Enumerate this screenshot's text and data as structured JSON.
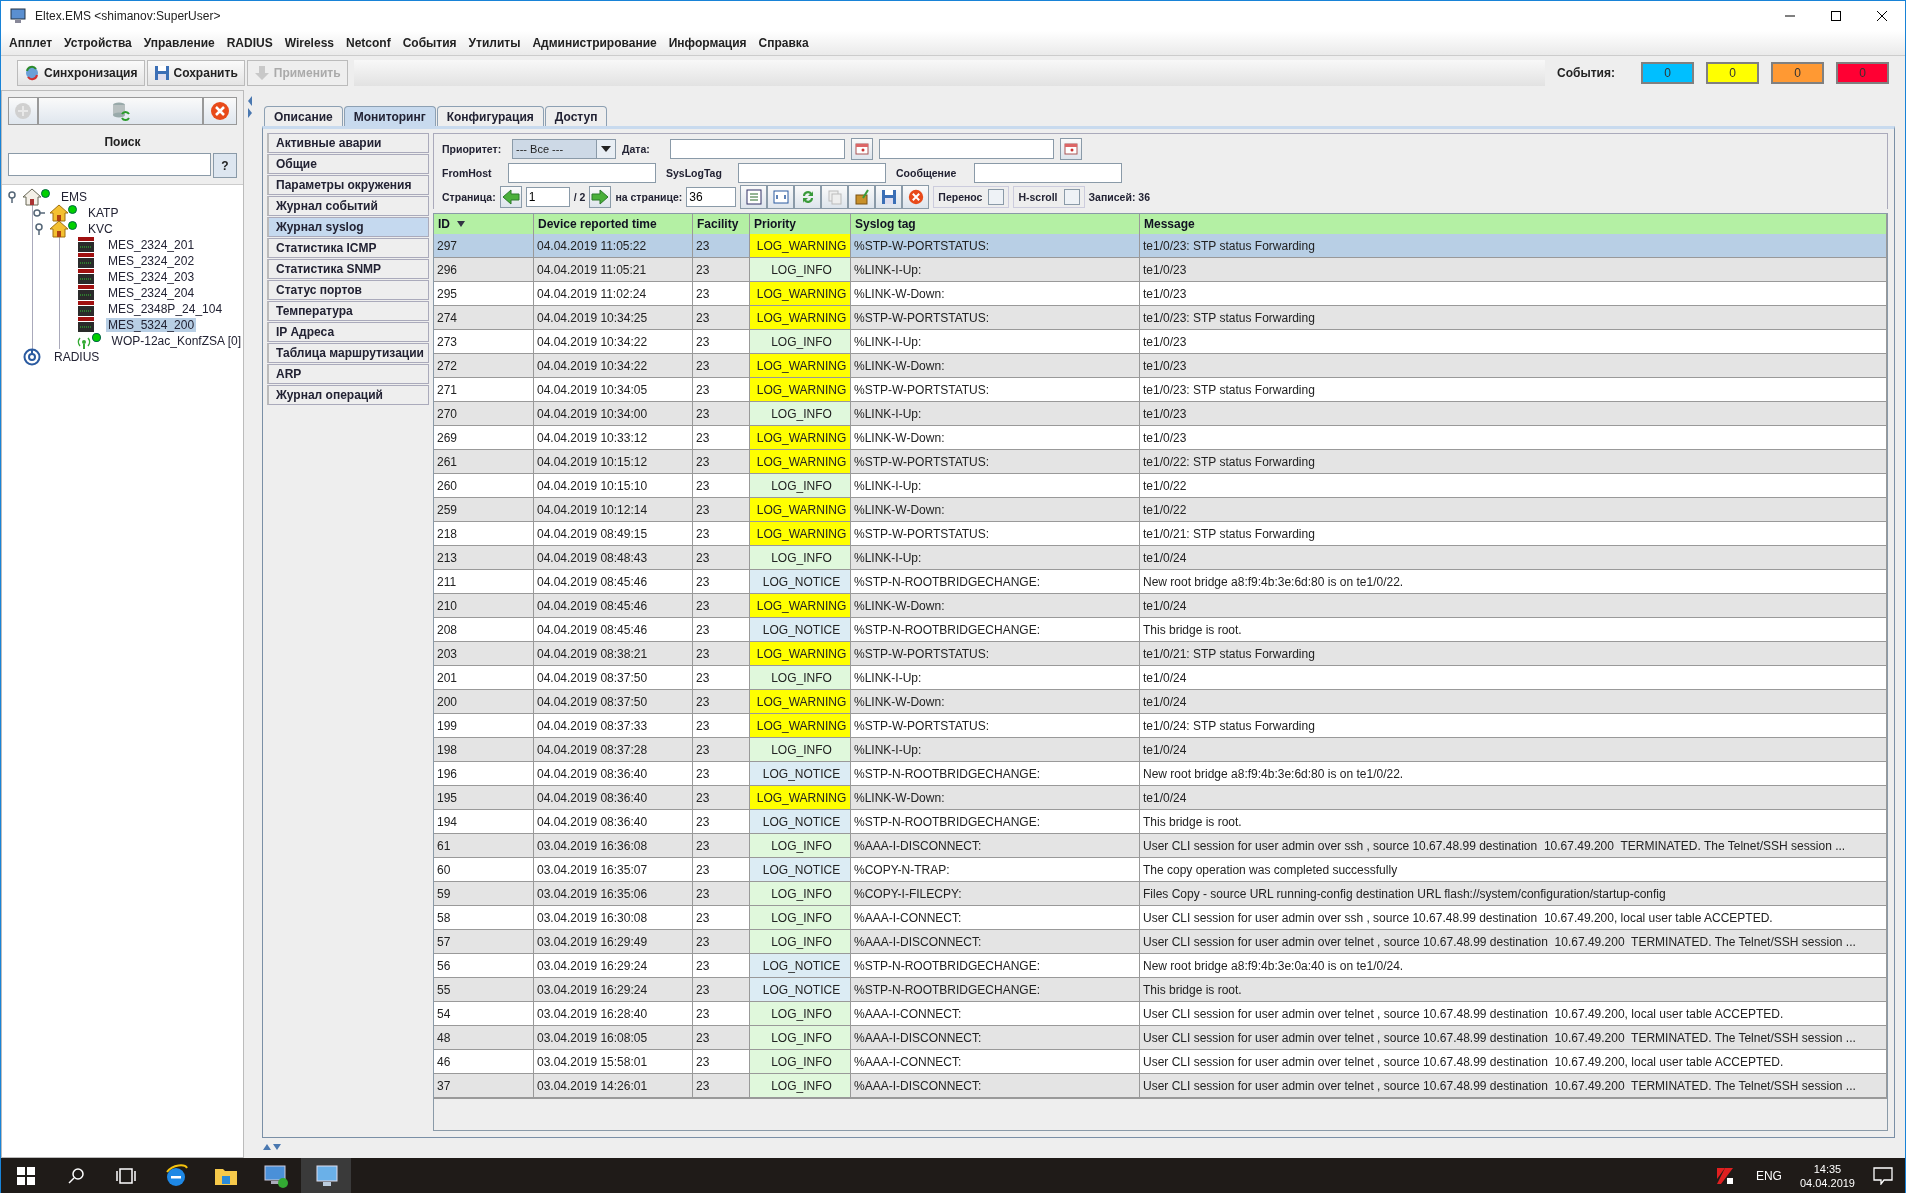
{
  "window": {
    "title": "Eltex.EMS <shimanov:SuperUser>"
  },
  "menu": [
    "Апплет",
    "Устройства",
    "Управление",
    "RADIUS",
    "Wireless",
    "Netconf",
    "События",
    "Утилиты",
    "Администрирование",
    "Информация",
    "Справка"
  ],
  "toolbar": [
    {
      "label": "Синхронизация",
      "kind": "sync",
      "disabled": false
    },
    {
      "label": "Сохранить",
      "kind": "save",
      "disabled": false
    },
    {
      "label": "Применить",
      "kind": "apply",
      "disabled": true
    }
  ],
  "events": {
    "label": "События:",
    "counters": [
      {
        "value": "0",
        "color": "#00bfff"
      },
      {
        "value": "0",
        "color": "#ffff00"
      },
      {
        "value": "0",
        "color": "#ff9933"
      },
      {
        "value": "0",
        "color": "#ff0033"
      }
    ]
  },
  "left_panel": {
    "search_label": "Поиск",
    "help_button": "?",
    "tree": [
      {
        "label": "EMS",
        "kind": "root",
        "online": true,
        "expanded": true,
        "selected": false,
        "children": [
          {
            "label": "KATP",
            "kind": "site",
            "online": true,
            "expanded": false,
            "selected": false
          },
          {
            "label": "KVC",
            "kind": "site",
            "online": true,
            "expanded": true,
            "selected": false,
            "children": [
              {
                "label": "MES_2324_201",
                "kind": "switch",
                "online": false,
                "selected": false
              },
              {
                "label": "MES_2324_202",
                "kind": "switch",
                "online": false,
                "selected": false
              },
              {
                "label": "MES_2324_203",
                "kind": "switch",
                "online": false,
                "selected": false
              },
              {
                "label": "MES_2324_204",
                "kind": "switch",
                "online": false,
                "selected": false
              },
              {
                "label": "MES_2348P_24_104",
                "kind": "switch",
                "online": false,
                "selected": false
              },
              {
                "label": "MES_5324_200",
                "kind": "switch",
                "online": false,
                "selected": true
              },
              {
                "label": "WOP-12ac_KonfZSA [0]",
                "kind": "wireless",
                "online": true,
                "selected": false
              }
            ]
          }
        ]
      },
      {
        "label": "RADIUS",
        "kind": "radius",
        "online": false,
        "selected": false
      }
    ]
  },
  "tabs": [
    {
      "label": "Описание",
      "selected": false
    },
    {
      "label": "Мониторинг",
      "selected": true
    },
    {
      "label": "Конфигурация",
      "selected": false
    },
    {
      "label": "Доступ",
      "selected": false
    }
  ],
  "nav": [
    {
      "label": "Активные аварии",
      "selected": false
    },
    {
      "label": "Общие",
      "selected": false
    },
    {
      "label": "Параметры окружения",
      "selected": false
    },
    {
      "label": "Журнал событий",
      "selected": false
    },
    {
      "label": "Журнал syslog",
      "selected": true
    },
    {
      "label": "Статистика ICMP",
      "selected": false
    },
    {
      "label": "Статистика SNMP",
      "selected": false
    },
    {
      "label": "Статус портов",
      "selected": false
    },
    {
      "label": "Температура",
      "selected": false
    },
    {
      "label": "IP Адреса",
      "selected": false
    },
    {
      "label": "Таблица маршрутизации",
      "selected": false
    },
    {
      "label": "ARP",
      "selected": false
    },
    {
      "label": "Журнал операций",
      "selected": false
    }
  ],
  "filters": {
    "priority_label": "Приоритет:",
    "priority_value": "--- Все ---",
    "date_label": "Дата:",
    "fromhost_label": "FromHost",
    "syslogtag_label": "SysLogTag",
    "message_label": "Сообщение",
    "page_label": "Страница:",
    "page_value": "1",
    "page_total": "/ 2",
    "per_page_label": "на странице:",
    "per_page_value": "36",
    "wrap": {
      "label": "Перенос",
      "checked": false
    },
    "hscroll": {
      "label": "H-scroll",
      "checked": false
    },
    "records": "Записей: 36"
  },
  "table": {
    "columns": [
      {
        "label": "ID",
        "sorted": true
      },
      {
        "label": "Device reported time",
        "sorted": false
      },
      {
        "label": "Facility",
        "sorted": false
      },
      {
        "label": "Priority",
        "sorted": false
      },
      {
        "label": "Syslog tag",
        "sorted": false
      },
      {
        "label": "Message",
        "sorted": false
      }
    ],
    "rows": [
      {
        "id": "297",
        "time": "04.04.2019 11:05:22",
        "facility": "23",
        "priority": "LOG_WARNING",
        "color": "#ffff00",
        "tag": "%STP-W-PORTSTATUS:",
        "message": "te1/0/23: STP status Forwarding",
        "selected": true
      },
      {
        "id": "296",
        "time": "04.04.2019 11:05:21",
        "facility": "23",
        "priority": "LOG_INFO",
        "color": "#e0f8dc",
        "tag": "%LINK-I-Up:",
        "message": "te1/0/23",
        "selected": false
      },
      {
        "id": "295",
        "time": "04.04.2019 11:02:24",
        "facility": "23",
        "priority": "LOG_WARNING",
        "color": "#ffff00",
        "tag": "%LINK-W-Down:",
        "message": "te1/0/23",
        "selected": false
      },
      {
        "id": "274",
        "time": "04.04.2019 10:34:25",
        "facility": "23",
        "priority": "LOG_WARNING",
        "color": "#ffff00",
        "tag": "%STP-W-PORTSTATUS:",
        "message": "te1/0/23: STP status Forwarding",
        "selected": false
      },
      {
        "id": "273",
        "time": "04.04.2019 10:34:22",
        "facility": "23",
        "priority": "LOG_INFO",
        "color": "#e0f8dc",
        "tag": "%LINK-I-Up:",
        "message": "te1/0/23",
        "selected": false
      },
      {
        "id": "272",
        "time": "04.04.2019 10:34:22",
        "facility": "23",
        "priority": "LOG_WARNING",
        "color": "#ffff00",
        "tag": "%LINK-W-Down:",
        "message": "te1/0/23",
        "selected": false
      },
      {
        "id": "271",
        "time": "04.04.2019 10:34:05",
        "facility": "23",
        "priority": "LOG_WARNING",
        "color": "#ffff00",
        "tag": "%STP-W-PORTSTATUS:",
        "message": "te1/0/23: STP status Forwarding",
        "selected": false
      },
      {
        "id": "270",
        "time": "04.04.2019 10:34:00",
        "facility": "23",
        "priority": "LOG_INFO",
        "color": "#e0f8dc",
        "tag": "%LINK-I-Up:",
        "message": "te1/0/23",
        "selected": false
      },
      {
        "id": "269",
        "time": "04.04.2019 10:33:12",
        "facility": "23",
        "priority": "LOG_WARNING",
        "color": "#ffff00",
        "tag": "%LINK-W-Down:",
        "message": "te1/0/23",
        "selected": false
      },
      {
        "id": "261",
        "time": "04.04.2019 10:15:12",
        "facility": "23",
        "priority": "LOG_WARNING",
        "color": "#ffff00",
        "tag": "%STP-W-PORTSTATUS:",
        "message": "te1/0/22: STP status Forwarding",
        "selected": false
      },
      {
        "id": "260",
        "time": "04.04.2019 10:15:10",
        "facility": "23",
        "priority": "LOG_INFO",
        "color": "#e0f8dc",
        "tag": "%LINK-I-Up:",
        "message": "te1/0/22",
        "selected": false
      },
      {
        "id": "259",
        "time": "04.04.2019 10:12:14",
        "facility": "23",
        "priority": "LOG_WARNING",
        "color": "#ffff00",
        "tag": "%LINK-W-Down:",
        "message": "te1/0/22",
        "selected": false
      },
      {
        "id": "218",
        "time": "04.04.2019 08:49:15",
        "facility": "23",
        "priority": "LOG_WARNING",
        "color": "#ffff00",
        "tag": "%STP-W-PORTSTATUS:",
        "message": "te1/0/21: STP status Forwarding",
        "selected": false
      },
      {
        "id": "213",
        "time": "04.04.2019 08:48:43",
        "facility": "23",
        "priority": "LOG_INFO",
        "color": "#e0f8dc",
        "tag": "%LINK-I-Up:",
        "message": "te1/0/24",
        "selected": false
      },
      {
        "id": "211",
        "time": "04.04.2019 08:45:46",
        "facility": "23",
        "priority": "LOG_NOTICE",
        "color": "#dcecf4",
        "tag": "%STP-N-ROOTBRIDGECHANGE:",
        "message": "New root bridge a8:f9:4b:3e:6d:80 is on te1/0/22.",
        "selected": false
      },
      {
        "id": "210",
        "time": "04.04.2019 08:45:46",
        "facility": "23",
        "priority": "LOG_WARNING",
        "color": "#ffff00",
        "tag": "%LINK-W-Down:",
        "message": "te1/0/24",
        "selected": false
      },
      {
        "id": "208",
        "time": "04.04.2019 08:45:46",
        "facility": "23",
        "priority": "LOG_NOTICE",
        "color": "#dcecf4",
        "tag": "%STP-N-ROOTBRIDGECHANGE:",
        "message": "This bridge is root.",
        "selected": false
      },
      {
        "id": "203",
        "time": "04.04.2019 08:38:21",
        "facility": "23",
        "priority": "LOG_WARNING",
        "color": "#ffff00",
        "tag": "%STP-W-PORTSTATUS:",
        "message": "te1/0/21: STP status Forwarding",
        "selected": false
      },
      {
        "id": "201",
        "time": "04.04.2019 08:37:50",
        "facility": "23",
        "priority": "LOG_INFO",
        "color": "#e0f8dc",
        "tag": "%LINK-I-Up:",
        "message": "te1/0/24",
        "selected": false
      },
      {
        "id": "200",
        "time": "04.04.2019 08:37:50",
        "facility": "23",
        "priority": "LOG_WARNING",
        "color": "#ffff00",
        "tag": "%LINK-W-Down:",
        "message": "te1/0/24",
        "selected": false
      },
      {
        "id": "199",
        "time": "04.04.2019 08:37:33",
        "facility": "23",
        "priority": "LOG_WARNING",
        "color": "#ffff00",
        "tag": "%STP-W-PORTSTATUS:",
        "message": "te1/0/24: STP status Forwarding",
        "selected": false
      },
      {
        "id": "198",
        "time": "04.04.2019 08:37:28",
        "facility": "23",
        "priority": "LOG_INFO",
        "color": "#e0f8dc",
        "tag": "%LINK-I-Up:",
        "message": "te1/0/24",
        "selected": false
      },
      {
        "id": "196",
        "time": "04.04.2019 08:36:40",
        "facility": "23",
        "priority": "LOG_NOTICE",
        "color": "#dcecf4",
        "tag": "%STP-N-ROOTBRIDGECHANGE:",
        "message": "New root bridge a8:f9:4b:3e:6d:80 is on te1/0/22.",
        "selected": false
      },
      {
        "id": "195",
        "time": "04.04.2019 08:36:40",
        "facility": "23",
        "priority": "LOG_WARNING",
        "color": "#ffff00",
        "tag": "%LINK-W-Down:",
        "message": "te1/0/24",
        "selected": false
      },
      {
        "id": "194",
        "time": "04.04.2019 08:36:40",
        "facility": "23",
        "priority": "LOG_NOTICE",
        "color": "#dcecf4",
        "tag": "%STP-N-ROOTBRIDGECHANGE:",
        "message": "This bridge is root.",
        "selected": false
      },
      {
        "id": "61",
        "time": "03.04.2019 16:36:08",
        "facility": "23",
        "priority": "LOG_INFO",
        "color": "#e0f8dc",
        "tag": "%AAA-I-DISCONNECT:",
        "message": "User CLI session for user admin over ssh , source 10.67.48.99 destination  10.67.49.200  TERMINATED. The Telnet/SSH session ...",
        "selected": false
      },
      {
        "id": "60",
        "time": "03.04.2019 16:35:07",
        "facility": "23",
        "priority": "LOG_NOTICE",
        "color": "#dcecf4",
        "tag": "%COPY-N-TRAP:",
        "message": "The copy operation was completed successfully",
        "selected": false
      },
      {
        "id": "59",
        "time": "03.04.2019 16:35:06",
        "facility": "23",
        "priority": "LOG_INFO",
        "color": "#e0f8dc",
        "tag": "%COPY-I-FILECPY:",
        "message": "Files Copy - source URL running-config destination URL flash://system/configuration/startup-config",
        "selected": false
      },
      {
        "id": "58",
        "time": "03.04.2019 16:30:08",
        "facility": "23",
        "priority": "LOG_INFO",
        "color": "#e0f8dc",
        "tag": "%AAA-I-CONNECT:",
        "message": "User CLI session for user admin over ssh , source 10.67.48.99 destination  10.67.49.200, local user table ACCEPTED.",
        "selected": false
      },
      {
        "id": "57",
        "time": "03.04.2019 16:29:49",
        "facility": "23",
        "priority": "LOG_INFO",
        "color": "#e0f8dc",
        "tag": "%AAA-I-DISCONNECT:",
        "message": "User CLI session for user admin over telnet , source 10.67.48.99 destination  10.67.49.200  TERMINATED. The Telnet/SSH session ...",
        "selected": false
      },
      {
        "id": "56",
        "time": "03.04.2019 16:29:24",
        "facility": "23",
        "priority": "LOG_NOTICE",
        "color": "#dcecf4",
        "tag": "%STP-N-ROOTBRIDGECHANGE:",
        "message": "New root bridge a8:f9:4b:3e:0a:40 is on te1/0/24.",
        "selected": false
      },
      {
        "id": "55",
        "time": "03.04.2019 16:29:24",
        "facility": "23",
        "priority": "LOG_NOTICE",
        "color": "#dcecf4",
        "tag": "%STP-N-ROOTBRIDGECHANGE:",
        "message": "This bridge is root.",
        "selected": false
      },
      {
        "id": "54",
        "time": "03.04.2019 16:28:40",
        "facility": "23",
        "priority": "LOG_INFO",
        "color": "#e0f8dc",
        "tag": "%AAA-I-CONNECT:",
        "message": "User CLI session for user admin over telnet , source 10.67.48.99 destination  10.67.49.200, local user table ACCEPTED.",
        "selected": false
      },
      {
        "id": "48",
        "time": "03.04.2019 16:08:05",
        "facility": "23",
        "priority": "LOG_INFO",
        "color": "#e0f8dc",
        "tag": "%AAA-I-DISCONNECT:",
        "message": "User CLI session for user admin over telnet , source 10.67.48.99 destination  10.67.49.200  TERMINATED. The Telnet/SSH session ...",
        "selected": false
      },
      {
        "id": "46",
        "time": "03.04.2019 15:58:01",
        "facility": "23",
        "priority": "LOG_INFO",
        "color": "#e0f8dc",
        "tag": "%AAA-I-CONNECT:",
        "message": "User CLI session for user admin over telnet , source 10.67.48.99 destination  10.67.49.200, local user table ACCEPTED.",
        "selected": false
      },
      {
        "id": "37",
        "time": "03.04.2019 14:26:01",
        "facility": "23",
        "priority": "LOG_INFO",
        "color": "#e0f8dc",
        "tag": "%AAA-I-DISCONNECT:",
        "message": "User CLI session for user admin over telnet , source 10.67.48.99 destination  10.67.49.200  TERMINATED. The Telnet/SSH session ...",
        "selected": false
      }
    ]
  },
  "taskbar": {
    "language": "ENG",
    "time": "14:35",
    "date": "04.04.2019"
  }
}
